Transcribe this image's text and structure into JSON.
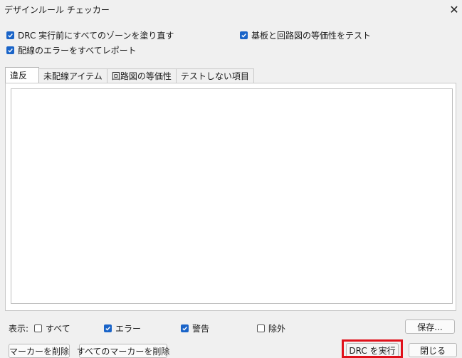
{
  "window": {
    "title": "デザインルール チェッカー",
    "close_glyph": "✕"
  },
  "options": {
    "refill_zones": {
      "label": "DRC 実行前にすべてのゾーンを塗り直す",
      "checked": true
    },
    "report_unconnected": {
      "label": "配線のエラーをすべてレポート",
      "checked": true
    },
    "test_parity": {
      "label": "基板と回路図の等価性をテスト",
      "checked": true
    }
  },
  "tabs": [
    {
      "label": "違反",
      "active": true
    },
    {
      "label": "未配線アイテム",
      "active": false
    },
    {
      "label": "回路図の等価性",
      "active": false
    },
    {
      "label": "テストしない項目",
      "active": false
    }
  ],
  "filters": {
    "label": "表示:",
    "all": {
      "label": "すべて",
      "checked": false
    },
    "errors": {
      "label": "エラー",
      "checked": true
    },
    "warnings": {
      "label": "警告",
      "checked": true
    },
    "exclusions": {
      "label": "除外",
      "checked": false
    }
  },
  "buttons": {
    "save": "保存...",
    "delete_marker": "マーカーを削除",
    "delete_all_markers": "すべてのマーカーを削除",
    "run_drc": "DRC を実行",
    "close": "閉じる"
  },
  "colors": {
    "accent": "#1a64c8",
    "highlight": "#e0101a"
  }
}
